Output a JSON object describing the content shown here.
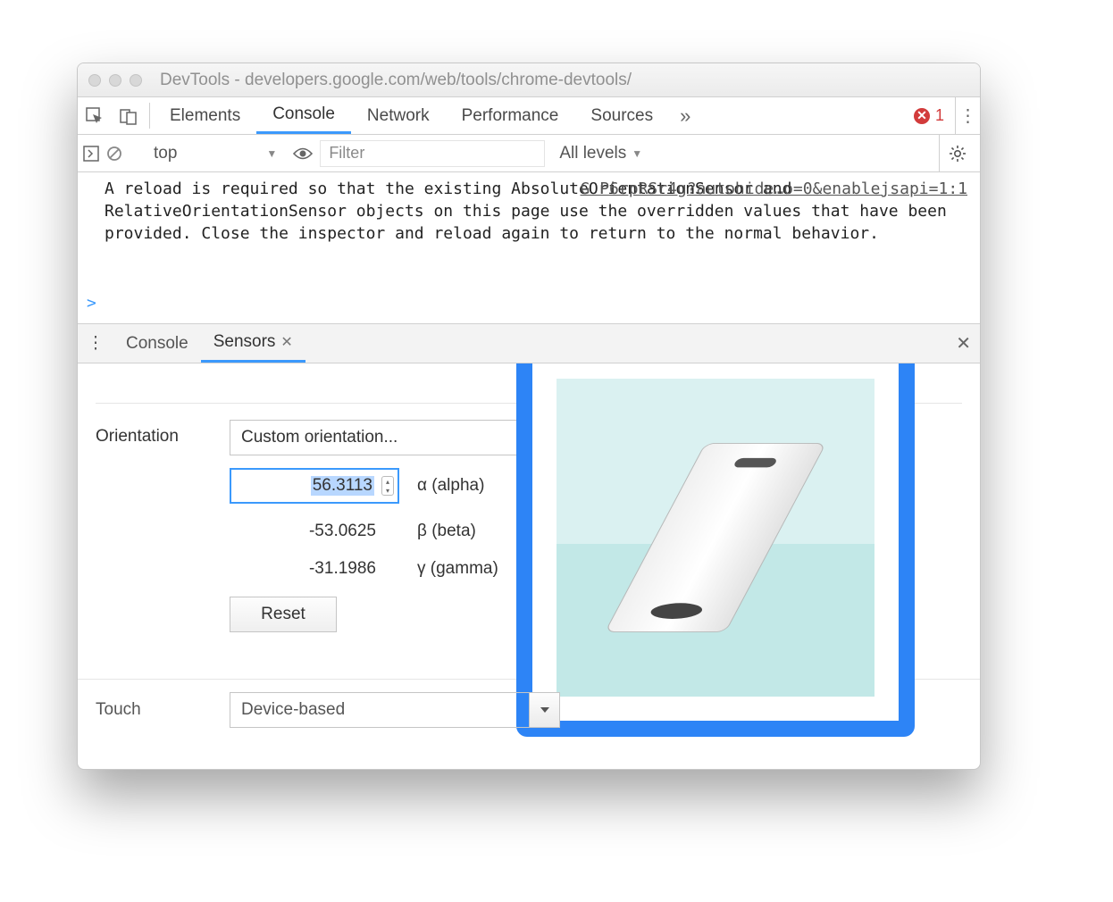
{
  "window": {
    "title": "DevTools - developers.google.com/web/tools/chrome-devtools/"
  },
  "tabs": {
    "items": [
      "Elements",
      "Console",
      "Network",
      "Performance",
      "Sources"
    ],
    "active_index": 1,
    "error_count": "1"
  },
  "console_bar": {
    "context": "top",
    "filter_placeholder": "Filter",
    "levels_label": "All levels"
  },
  "console": {
    "message": "A reload is required so that the existing AbsoluteOrientationSensor and RelativeOrientationSensor objects on this page use the overridden values that have been provided. Close the inspector and reload again to return to the normal behavior.",
    "source": "G P6rpRSr4g?autohide…o=0&enablejsapi=1:1",
    "prompt": ">"
  },
  "drawer": {
    "tabs": [
      "Console",
      "Sensors"
    ],
    "active_index": 1
  },
  "sensors": {
    "section_label": "Orientation",
    "preset": "Custom orientation...",
    "alpha": {
      "value": "56.3113",
      "label": "α (alpha)"
    },
    "beta": {
      "value": "-53.0625",
      "label": "β (beta)"
    },
    "gamma": {
      "value": "-31.1986",
      "label": "γ (gamma)"
    },
    "reset_label": "Reset",
    "touch_label": "Touch",
    "touch_value": "Device-based"
  }
}
